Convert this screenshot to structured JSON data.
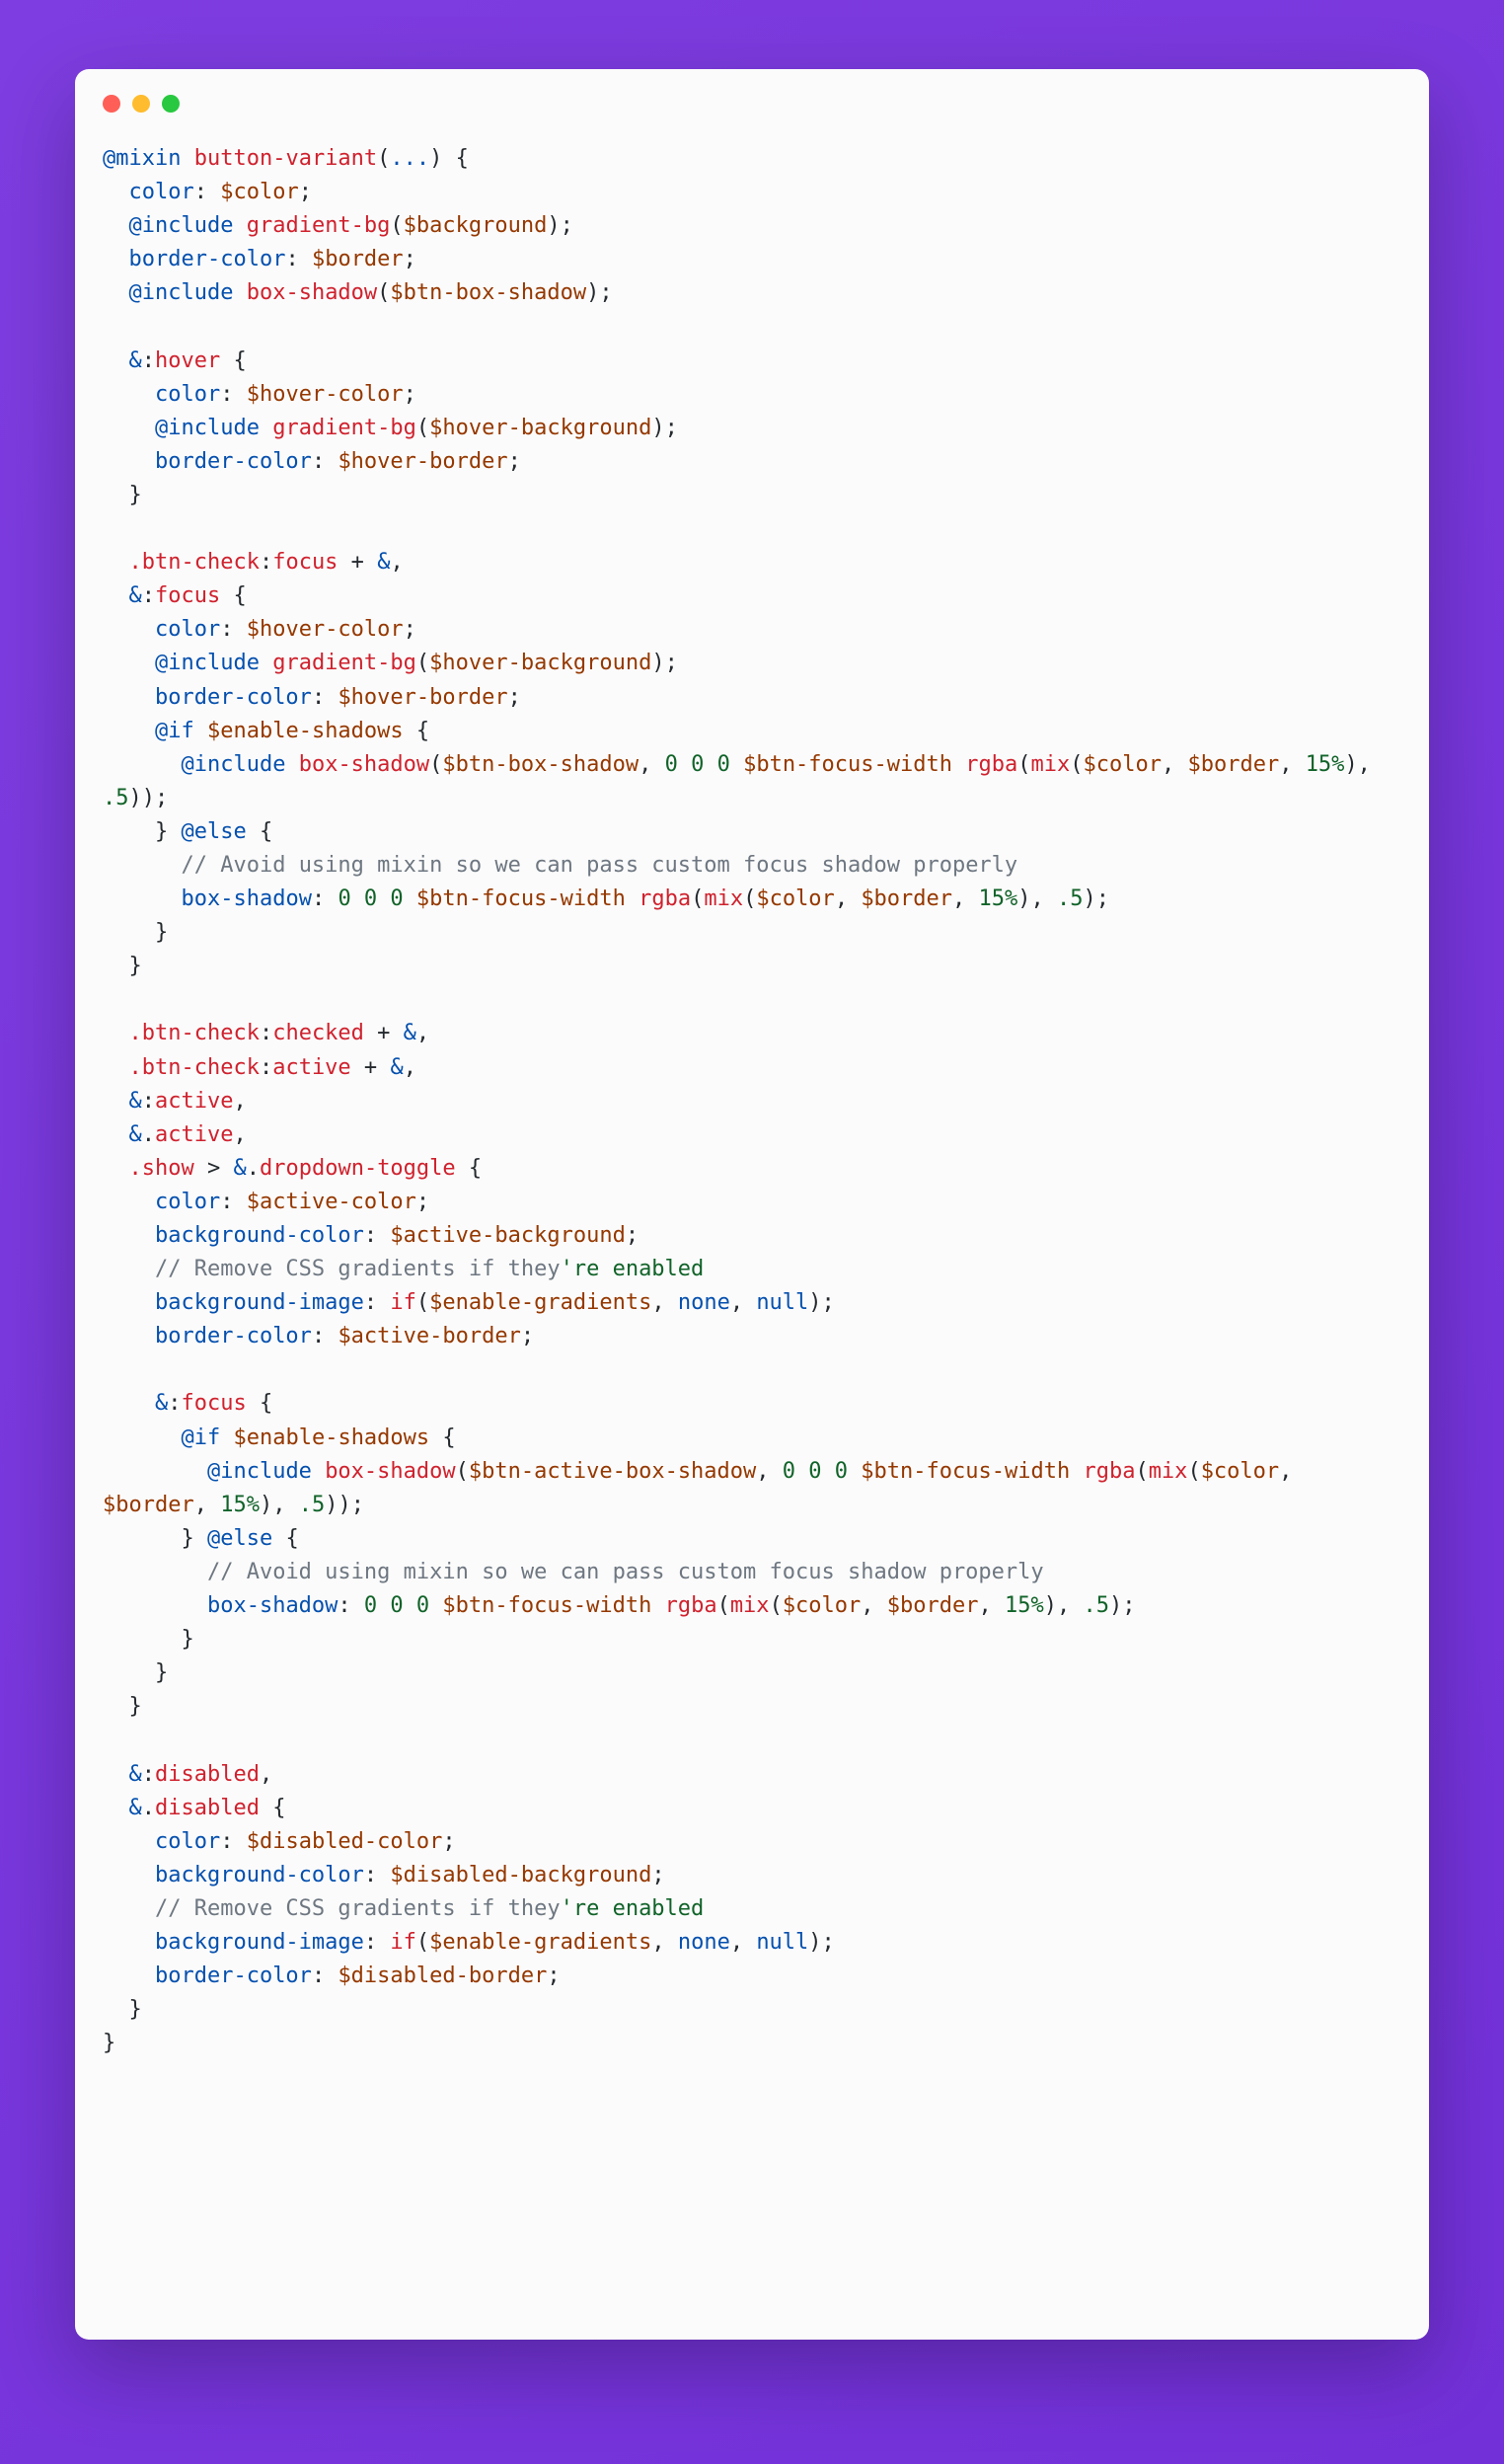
{
  "window": {
    "dots": [
      "red",
      "yellow",
      "green"
    ]
  },
  "syntax_colors": {
    "keyword": "#0550AE",
    "name": "#CF222E",
    "variable": "#953800",
    "number": "#116329",
    "comment": "#6E7781",
    "text": "#24292E"
  },
  "code": {
    "lines": [
      [
        [
          "k",
          "@mixin"
        ],
        [
          "t",
          " "
        ],
        [
          "f",
          "button-variant"
        ],
        [
          "t",
          "("
        ],
        [
          "k",
          "..."
        ],
        [
          "t",
          ") {"
        ]
      ],
      [
        [
          "t",
          "  "
        ],
        [
          "k",
          "color"
        ],
        [
          "t",
          ": "
        ],
        [
          "v",
          "$color"
        ],
        [
          "t",
          ";"
        ]
      ],
      [
        [
          "t",
          "  "
        ],
        [
          "k",
          "@include"
        ],
        [
          "t",
          " "
        ],
        [
          "f",
          "gradient-bg"
        ],
        [
          "t",
          "("
        ],
        [
          "v",
          "$background"
        ],
        [
          "t",
          ");"
        ]
      ],
      [
        [
          "t",
          "  "
        ],
        [
          "k",
          "border-color"
        ],
        [
          "t",
          ": "
        ],
        [
          "v",
          "$border"
        ],
        [
          "t",
          ";"
        ]
      ],
      [
        [
          "t",
          "  "
        ],
        [
          "k",
          "@include"
        ],
        [
          "t",
          " "
        ],
        [
          "f",
          "box-shadow"
        ],
        [
          "t",
          "("
        ],
        [
          "v",
          "$btn-box-shadow"
        ],
        [
          "t",
          ");"
        ]
      ],
      [
        [
          "t",
          ""
        ]
      ],
      [
        [
          "t",
          "  "
        ],
        [
          "k",
          "&"
        ],
        [
          "t",
          ":"
        ],
        [
          "f",
          "hover"
        ],
        [
          "t",
          " {"
        ]
      ],
      [
        [
          "t",
          "    "
        ],
        [
          "k",
          "color"
        ],
        [
          "t",
          ": "
        ],
        [
          "v",
          "$hover-color"
        ],
        [
          "t",
          ";"
        ]
      ],
      [
        [
          "t",
          "    "
        ],
        [
          "k",
          "@include"
        ],
        [
          "t",
          " "
        ],
        [
          "f",
          "gradient-bg"
        ],
        [
          "t",
          "("
        ],
        [
          "v",
          "$hover-background"
        ],
        [
          "t",
          ");"
        ]
      ],
      [
        [
          "t",
          "    "
        ],
        [
          "k",
          "border-color"
        ],
        [
          "t",
          ": "
        ],
        [
          "v",
          "$hover-border"
        ],
        [
          "t",
          ";"
        ]
      ],
      [
        [
          "t",
          "  }"
        ]
      ],
      [
        [
          "t",
          ""
        ]
      ],
      [
        [
          "t",
          "  "
        ],
        [
          "f",
          ".btn-check"
        ],
        [
          "t",
          ":"
        ],
        [
          "f",
          "focus"
        ],
        [
          "t",
          " + "
        ],
        [
          "k",
          "&"
        ],
        [
          "t",
          ","
        ]
      ],
      [
        [
          "t",
          "  "
        ],
        [
          "k",
          "&"
        ],
        [
          "t",
          ":"
        ],
        [
          "f",
          "focus"
        ],
        [
          "t",
          " {"
        ]
      ],
      [
        [
          "t",
          "    "
        ],
        [
          "k",
          "color"
        ],
        [
          "t",
          ": "
        ],
        [
          "v",
          "$hover-color"
        ],
        [
          "t",
          ";"
        ]
      ],
      [
        [
          "t",
          "    "
        ],
        [
          "k",
          "@include"
        ],
        [
          "t",
          " "
        ],
        [
          "f",
          "gradient-bg"
        ],
        [
          "t",
          "("
        ],
        [
          "v",
          "$hover-background"
        ],
        [
          "t",
          ");"
        ]
      ],
      [
        [
          "t",
          "    "
        ],
        [
          "k",
          "border-color"
        ],
        [
          "t",
          ": "
        ],
        [
          "v",
          "$hover-border"
        ],
        [
          "t",
          ";"
        ]
      ],
      [
        [
          "t",
          "    "
        ],
        [
          "k",
          "@if"
        ],
        [
          "t",
          " "
        ],
        [
          "v",
          "$enable-shadows"
        ],
        [
          "t",
          " {"
        ]
      ],
      [
        [
          "t",
          "      "
        ],
        [
          "k",
          "@include"
        ],
        [
          "t",
          " "
        ],
        [
          "f",
          "box-shadow"
        ],
        [
          "t",
          "("
        ],
        [
          "v",
          "$btn-box-shadow"
        ],
        [
          "t",
          ", "
        ],
        [
          "n",
          "0 0 0"
        ],
        [
          "t",
          " "
        ],
        [
          "v",
          "$btn-focus-width"
        ],
        [
          "t",
          " "
        ],
        [
          "f",
          "rgba"
        ],
        [
          "t",
          "("
        ],
        [
          "f",
          "mix"
        ],
        [
          "t",
          "("
        ],
        [
          "v",
          "$color"
        ],
        [
          "t",
          ", "
        ],
        [
          "v",
          "$border"
        ],
        [
          "t",
          ", "
        ],
        [
          "n",
          "15%"
        ],
        [
          "t",
          "), "
        ],
        [
          "n",
          ".5"
        ],
        [
          "t",
          "));"
        ]
      ],
      [
        [
          "t",
          "    } "
        ],
        [
          "k",
          "@else"
        ],
        [
          "t",
          " {"
        ]
      ],
      [
        [
          "t",
          "      "
        ],
        [
          "c",
          "// Avoid using mixin so we can pass custom focus shadow properly"
        ]
      ],
      [
        [
          "t",
          "      "
        ],
        [
          "k",
          "box-shadow"
        ],
        [
          "t",
          ": "
        ],
        [
          "n",
          "0 0 0"
        ],
        [
          "t",
          " "
        ],
        [
          "v",
          "$btn-focus-width"
        ],
        [
          "t",
          " "
        ],
        [
          "f",
          "rgba"
        ],
        [
          "t",
          "("
        ],
        [
          "f",
          "mix"
        ],
        [
          "t",
          "("
        ],
        [
          "v",
          "$color"
        ],
        [
          "t",
          ", "
        ],
        [
          "v",
          "$border"
        ],
        [
          "t",
          ", "
        ],
        [
          "n",
          "15%"
        ],
        [
          "t",
          "), "
        ],
        [
          "n",
          ".5"
        ],
        [
          "t",
          ");"
        ]
      ],
      [
        [
          "t",
          "    }"
        ]
      ],
      [
        [
          "t",
          "  }"
        ]
      ],
      [
        [
          "t",
          ""
        ]
      ],
      [
        [
          "t",
          "  "
        ],
        [
          "f",
          ".btn-check"
        ],
        [
          "t",
          ":"
        ],
        [
          "f",
          "checked"
        ],
        [
          "t",
          " + "
        ],
        [
          "k",
          "&"
        ],
        [
          "t",
          ","
        ]
      ],
      [
        [
          "t",
          "  "
        ],
        [
          "f",
          ".btn-check"
        ],
        [
          "t",
          ":"
        ],
        [
          "f",
          "active"
        ],
        [
          "t",
          " + "
        ],
        [
          "k",
          "&"
        ],
        [
          "t",
          ","
        ]
      ],
      [
        [
          "t",
          "  "
        ],
        [
          "k",
          "&"
        ],
        [
          "t",
          ":"
        ],
        [
          "f",
          "active"
        ],
        [
          "t",
          ","
        ]
      ],
      [
        [
          "t",
          "  "
        ],
        [
          "k",
          "&"
        ],
        [
          "t",
          "."
        ],
        [
          "f",
          "active"
        ],
        [
          "t",
          ","
        ]
      ],
      [
        [
          "t",
          "  "
        ],
        [
          "f",
          ".show"
        ],
        [
          "t",
          " > "
        ],
        [
          "k",
          "&"
        ],
        [
          "t",
          "."
        ],
        [
          "f",
          "dropdown-toggle"
        ],
        [
          "t",
          " {"
        ]
      ],
      [
        [
          "t",
          "    "
        ],
        [
          "k",
          "color"
        ],
        [
          "t",
          ": "
        ],
        [
          "v",
          "$active-color"
        ],
        [
          "t",
          ";"
        ]
      ],
      [
        [
          "t",
          "    "
        ],
        [
          "k",
          "background-color"
        ],
        [
          "t",
          ": "
        ],
        [
          "v",
          "$active-background"
        ],
        [
          "t",
          ";"
        ]
      ],
      [
        [
          "t",
          "    "
        ],
        [
          "c",
          "// Remove CSS gradients if they"
        ],
        [
          "n",
          "'re enabled"
        ]
      ],
      [
        [
          "t",
          "    "
        ],
        [
          "k",
          "background-image"
        ],
        [
          "t",
          ": "
        ],
        [
          "f",
          "if"
        ],
        [
          "t",
          "("
        ],
        [
          "v",
          "$enable-gradients"
        ],
        [
          "t",
          ", "
        ],
        [
          "k",
          "none"
        ],
        [
          "t",
          ", "
        ],
        [
          "k",
          "null"
        ],
        [
          "t",
          ");"
        ]
      ],
      [
        [
          "t",
          "    "
        ],
        [
          "k",
          "border-color"
        ],
        [
          "t",
          ": "
        ],
        [
          "v",
          "$active-border"
        ],
        [
          "t",
          ";"
        ]
      ],
      [
        [
          "t",
          ""
        ]
      ],
      [
        [
          "t",
          "    "
        ],
        [
          "k",
          "&"
        ],
        [
          "t",
          ":"
        ],
        [
          "f",
          "focus"
        ],
        [
          "t",
          " {"
        ]
      ],
      [
        [
          "t",
          "      "
        ],
        [
          "k",
          "@if"
        ],
        [
          "t",
          " "
        ],
        [
          "v",
          "$enable-shadows"
        ],
        [
          "t",
          " {"
        ]
      ],
      [
        [
          "t",
          "        "
        ],
        [
          "k",
          "@include"
        ],
        [
          "t",
          " "
        ],
        [
          "f",
          "box-shadow"
        ],
        [
          "t",
          "("
        ],
        [
          "v",
          "$btn-active-box-shadow"
        ],
        [
          "t",
          ", "
        ],
        [
          "n",
          "0 0 0"
        ],
        [
          "t",
          " "
        ],
        [
          "v",
          "$btn-focus-width"
        ],
        [
          "t",
          " "
        ],
        [
          "f",
          "rgba"
        ],
        [
          "t",
          "("
        ],
        [
          "f",
          "mix"
        ],
        [
          "t",
          "("
        ],
        [
          "v",
          "$color"
        ],
        [
          "t",
          ", "
        ],
        [
          "v",
          "$border"
        ],
        [
          "t",
          ", "
        ],
        [
          "n",
          "15%"
        ],
        [
          "t",
          "), "
        ],
        [
          "n",
          ".5"
        ],
        [
          "t",
          "));"
        ]
      ],
      [
        [
          "t",
          "      } "
        ],
        [
          "k",
          "@else"
        ],
        [
          "t",
          " {"
        ]
      ],
      [
        [
          "t",
          "        "
        ],
        [
          "c",
          "// Avoid using mixin so we can pass custom focus shadow properly"
        ]
      ],
      [
        [
          "t",
          "        "
        ],
        [
          "k",
          "box-shadow"
        ],
        [
          "t",
          ": "
        ],
        [
          "n",
          "0 0 0"
        ],
        [
          "t",
          " "
        ],
        [
          "v",
          "$btn-focus-width"
        ],
        [
          "t",
          " "
        ],
        [
          "f",
          "rgba"
        ],
        [
          "t",
          "("
        ],
        [
          "f",
          "mix"
        ],
        [
          "t",
          "("
        ],
        [
          "v",
          "$color"
        ],
        [
          "t",
          ", "
        ],
        [
          "v",
          "$border"
        ],
        [
          "t",
          ", "
        ],
        [
          "n",
          "15%"
        ],
        [
          "t",
          "), "
        ],
        [
          "n",
          ".5"
        ],
        [
          "t",
          ");"
        ]
      ],
      [
        [
          "t",
          "      }"
        ]
      ],
      [
        [
          "t",
          "    }"
        ]
      ],
      [
        [
          "t",
          "  }"
        ]
      ],
      [
        [
          "t",
          ""
        ]
      ],
      [
        [
          "t",
          "  "
        ],
        [
          "k",
          "&"
        ],
        [
          "t",
          ":"
        ],
        [
          "f",
          "disabled"
        ],
        [
          "t",
          ","
        ]
      ],
      [
        [
          "t",
          "  "
        ],
        [
          "k",
          "&"
        ],
        [
          "t",
          "."
        ],
        [
          "f",
          "disabled"
        ],
        [
          "t",
          " {"
        ]
      ],
      [
        [
          "t",
          "    "
        ],
        [
          "k",
          "color"
        ],
        [
          "t",
          ": "
        ],
        [
          "v",
          "$disabled-color"
        ],
        [
          "t",
          ";"
        ]
      ],
      [
        [
          "t",
          "    "
        ],
        [
          "k",
          "background-color"
        ],
        [
          "t",
          ": "
        ],
        [
          "v",
          "$disabled-background"
        ],
        [
          "t",
          ";"
        ]
      ],
      [
        [
          "t",
          "    "
        ],
        [
          "c",
          "// Remove CSS gradients if they"
        ],
        [
          "n",
          "'re enabled"
        ]
      ],
      [
        [
          "t",
          "    "
        ],
        [
          "k",
          "background-image"
        ],
        [
          "t",
          ": "
        ],
        [
          "f",
          "if"
        ],
        [
          "t",
          "("
        ],
        [
          "v",
          "$enable-gradients"
        ],
        [
          "t",
          ", "
        ],
        [
          "k",
          "none"
        ],
        [
          "t",
          ", "
        ],
        [
          "k",
          "null"
        ],
        [
          "t",
          ");"
        ]
      ],
      [
        [
          "t",
          "    "
        ],
        [
          "k",
          "border-color"
        ],
        [
          "t",
          ": "
        ],
        [
          "v",
          "$disabled-border"
        ],
        [
          "t",
          ";"
        ]
      ],
      [
        [
          "t",
          "  }"
        ]
      ],
      [
        [
          "t",
          "}"
        ]
      ]
    ]
  }
}
